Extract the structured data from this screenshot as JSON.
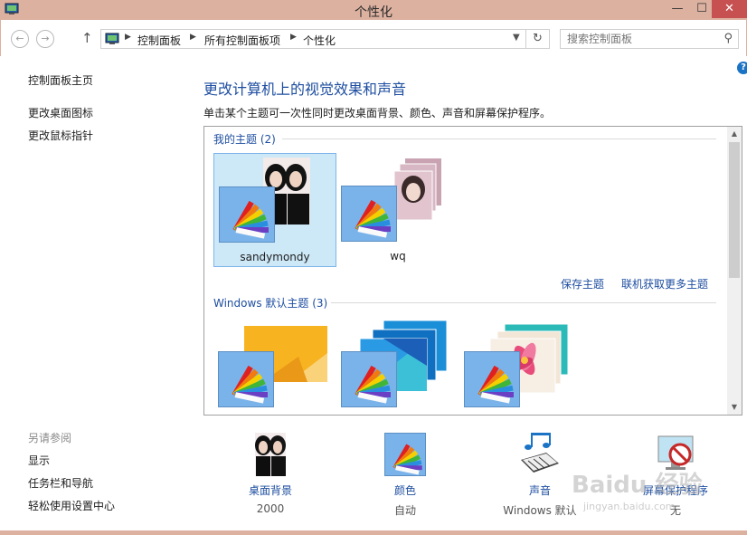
{
  "window": {
    "title": "个性化",
    "minimize": "—",
    "maximize": "☐",
    "close": "✕"
  },
  "nav": {
    "back": "←",
    "forward": "→",
    "up": "↑",
    "breadcrumbs": [
      "控制面板",
      "所有控制面板项",
      "个性化"
    ],
    "search_placeholder": "搜索控制面板"
  },
  "left": {
    "links": [
      "控制面板主页",
      "更改桌面图标",
      "更改鼠标指针"
    ],
    "see_also_title": "另请参阅",
    "see_also": [
      "显示",
      "任务栏和导航",
      "轻松使用设置中心"
    ]
  },
  "main": {
    "heading": "更改计算机上的视觉效果和声音",
    "description": "单击某个主题可一次性同时更改桌面背景、颜色、声音和屏幕保护程序。",
    "my_themes_title": "我的主题 (2)",
    "my_themes": [
      {
        "label": "sandymondy",
        "selected": true
      },
      {
        "label": "wq",
        "selected": false
      }
    ],
    "save_theme": "保存主题",
    "get_more": "联机获取更多主题",
    "windows_themes_title": "Windows 默认主题 (3)"
  },
  "bottom": [
    {
      "name": "桌面背景",
      "value": "2000",
      "icon": "desktop-background-icon"
    },
    {
      "name": "颜色",
      "value": "自动",
      "icon": "color-palette-icon"
    },
    {
      "name": "声音",
      "value": "Windows 默认",
      "icon": "sound-icon"
    },
    {
      "name": "屏幕保护程序",
      "value": "无",
      "icon": "screen-saver-icon"
    }
  ],
  "watermark": {
    "logo": "Baidu 经验",
    "url": "jingyan.baidu.com"
  },
  "colors": {
    "titlebar": "#dcb1a0",
    "link": "#1e4ea0",
    "selection": "#cde8f7"
  }
}
